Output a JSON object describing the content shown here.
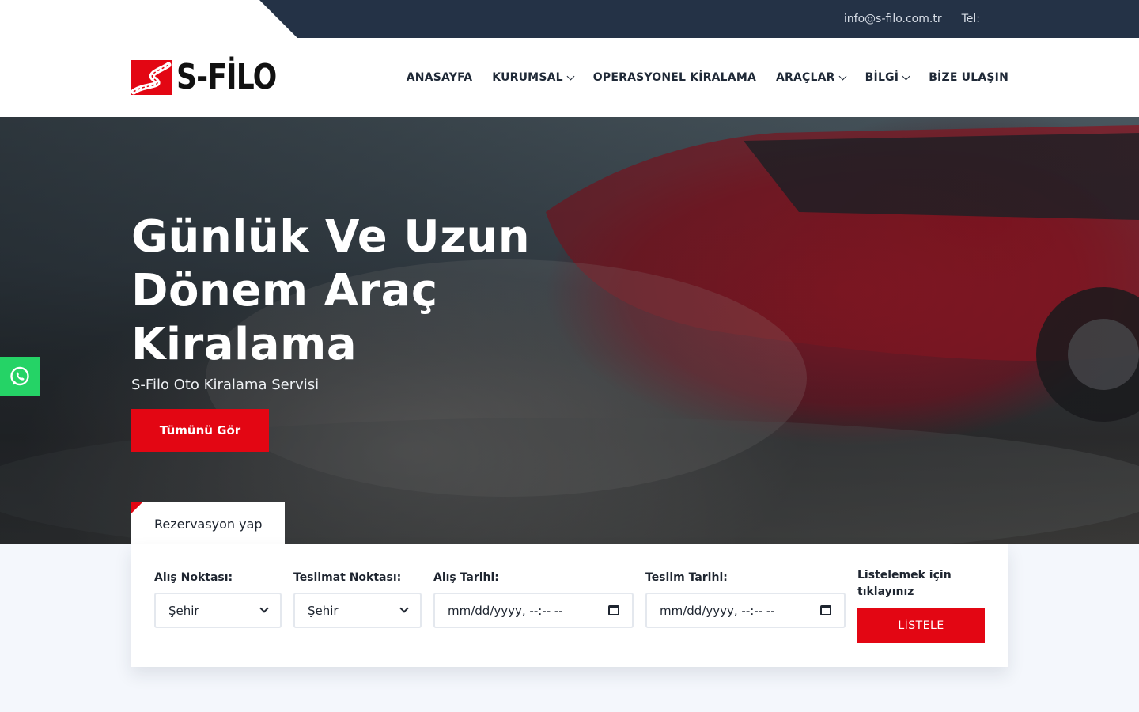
{
  "topbar": {
    "email": "info@s-filo.com.tr",
    "tel_label": "Tel:"
  },
  "brand": {
    "name": "S-FİLO",
    "accent_color": "#e30613",
    "dark_color": "#243246"
  },
  "nav": {
    "items": [
      {
        "label": "ANASAYFA",
        "has_dropdown": false
      },
      {
        "label": "KURUMSAL",
        "has_dropdown": true
      },
      {
        "label": "OPERASYONEL KİRALAMA",
        "has_dropdown": false
      },
      {
        "label": "ARAÇLAR",
        "has_dropdown": true
      },
      {
        "label": "BİLGİ",
        "has_dropdown": true
      },
      {
        "label": "BİZE ULAŞIN",
        "has_dropdown": false
      }
    ]
  },
  "hero": {
    "title": "Günlük Ve Uzun Dönem Araç Kiralama",
    "subtitle": "S-Filo Oto Kiralama Servisi",
    "button_label": "Tümünü Gör"
  },
  "reservation": {
    "tab_label": "Rezervasyon yap",
    "pickup_label": "Alış Noktası:",
    "pickup_value": "Şehir",
    "dropoff_label": "Teslimat Noktası:",
    "dropoff_value": "Şehir",
    "pickup_date_label": "Alış Tarihi:",
    "pickup_date_placeholder": "mm/dd/yyyy, --:-- --",
    "return_date_label": "Teslim Tarihi:",
    "return_date_placeholder": "mm/dd/yyyy, --:-- --",
    "list_hint": "Listelemek için tıklayınız",
    "list_button": "LİSTELE"
  },
  "icons": [
    "whatsapp-icon",
    "chevron-down-icon",
    "calendar-icon",
    "logo-road-icon"
  ]
}
